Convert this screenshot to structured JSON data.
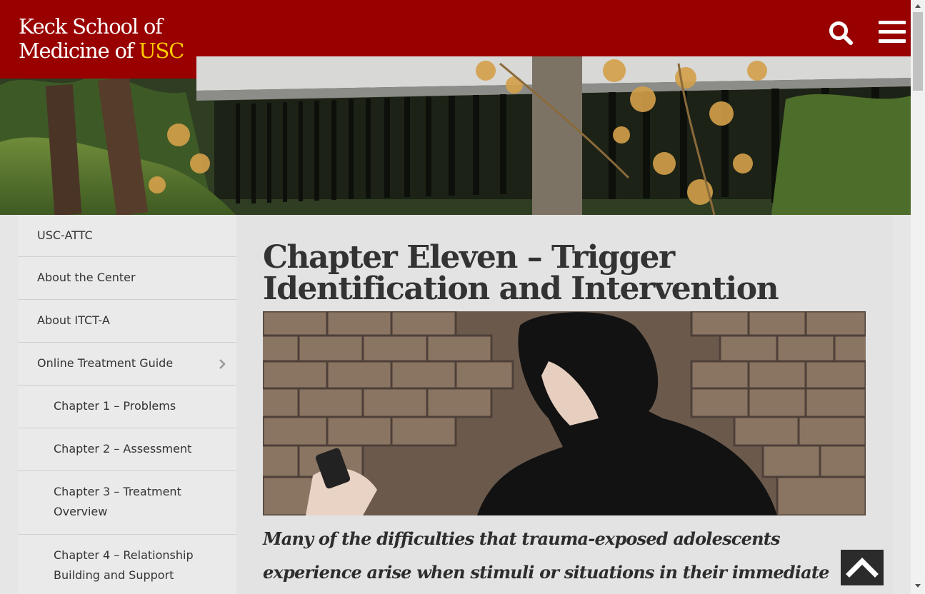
{
  "header": {
    "logo_line1": "Keck School of",
    "logo_line2_prefix": "Medicine of ",
    "logo_line2_accent": "USC",
    "search_icon": "search-icon",
    "menu_icon": "hamburger-menu-icon"
  },
  "hero": {
    "image": "campus-garden-photo"
  },
  "sidebar": {
    "items": [
      {
        "label": "USC-ATTC"
      },
      {
        "label": "About the Center"
      },
      {
        "label": "About ITCT-A"
      },
      {
        "label": "Online Treatment Guide",
        "icon": "chevron-right-icon"
      }
    ],
    "subitems": [
      {
        "label": "Chapter 1 – Problems"
      },
      {
        "label": "Chapter 2 – Assessment"
      },
      {
        "label": "Chapter 3 – Treatment Overview"
      },
      {
        "label": "Chapter 4 – Relationship Building and Support"
      }
    ]
  },
  "main": {
    "title": "Chapter Eleven – Trigger Identification and Intervention",
    "image": "teen-against-brick-wall-photo",
    "intro": "Many of the difficulties that trauma-exposed adolescents experience arise when stimuli or situations in their immediate environment"
  },
  "back_to_top": {
    "icon": "chevron-up-icon"
  },
  "colors": {
    "brand_red": "#990000",
    "brand_gold": "#ffcc00",
    "sidebar_bg": "#eaeaea",
    "text": "#333333"
  }
}
